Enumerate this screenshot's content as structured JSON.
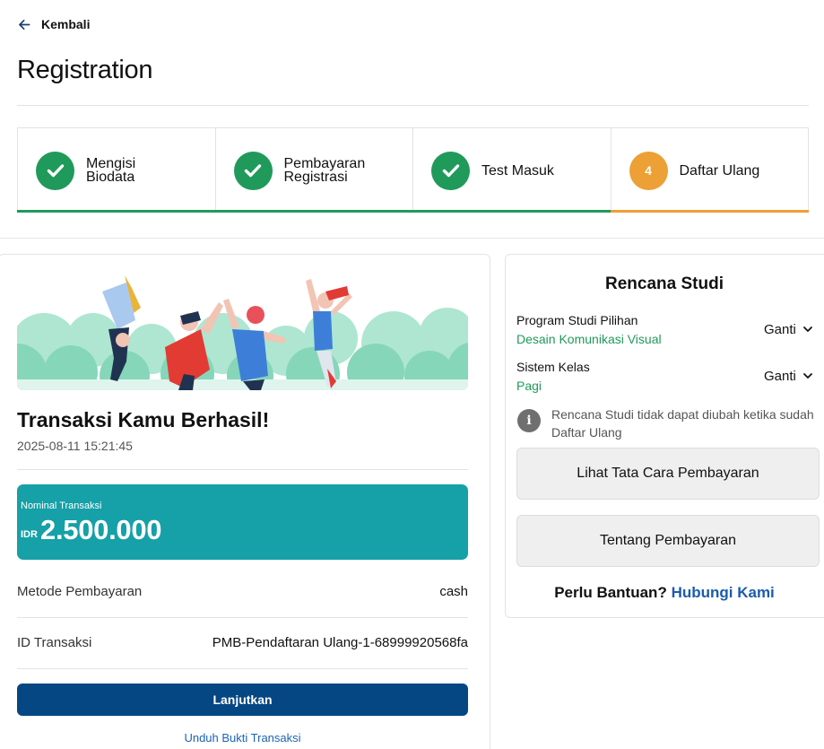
{
  "nav": {
    "back_label": "Kembali"
  },
  "page": {
    "title": "Registration"
  },
  "steps": [
    {
      "number": "1",
      "label": "Mengisi Biodata",
      "status": "done"
    },
    {
      "number": "2",
      "label": "Pembayaran Registrasi",
      "status": "done"
    },
    {
      "number": "3",
      "label": "Test Masuk",
      "status": "done"
    },
    {
      "number": "4",
      "label": "Daftar Ulang",
      "status": "current"
    }
  ],
  "transaction": {
    "title": "Transaksi Kamu Berhasil!",
    "datetime": "2025-08-11 15:21:45",
    "amount_label": "Nominal Transaksi",
    "currency": "IDR",
    "amount": "2.500.000",
    "rows": [
      {
        "label": "Metode Pembayaran",
        "value": "cash"
      },
      {
        "label": "ID Transaksi",
        "value": "PMB-Pendaftaran Ulang-1-68999920568fa"
      }
    ],
    "continue_label": "Lanjutkan",
    "download_label": "Unduh Bukti Transaksi"
  },
  "study_plan": {
    "title": "Rencana Studi",
    "fields": [
      {
        "label": "Program Studi Pilihan",
        "value": "Desain Komunikasi Visual",
        "action": "Ganti"
      },
      {
        "label": "Sistem Kelas",
        "value": "Pagi",
        "action": "Ganti"
      }
    ],
    "notice": "Rencana Studi tidak dapat diubah ketika sudah Daftar Ulang",
    "payment_guide_label": "Lihat Tata Cara Pembayaran",
    "about_payment_label": "Tentang Pembayaran",
    "help_question": "Perlu Bantuan?",
    "help_link": "Hubungi Kami"
  },
  "colors": {
    "done": "#1f9a5a",
    "current": "#eca035",
    "amount_bg": "#16a0a7",
    "primary": "#054782",
    "link": "#1b63b3"
  }
}
